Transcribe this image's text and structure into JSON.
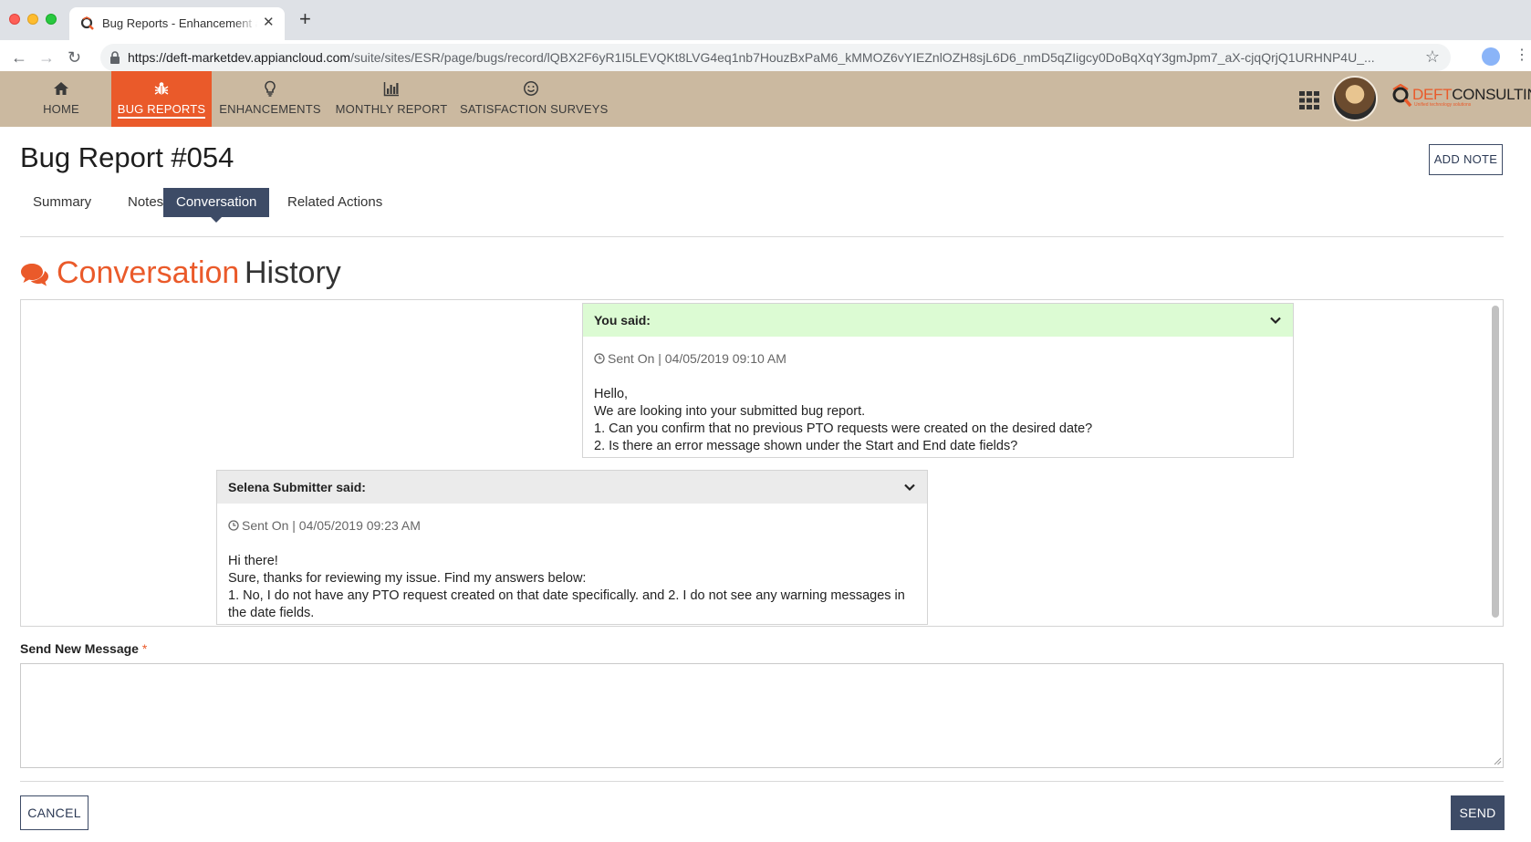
{
  "browser": {
    "tab_title": "Bug Reports - Enhancement and",
    "url_host": "https://deft-marketdev.appiancloud.com",
    "url_path": "/suite/sites/ESR/page/bugs/record/lQBX2F6yR1I5LEVQKt8LVG4eq1nb7HouzBxPaM6_kMMOZ6vYIEZnlOZH8sjL6D6_nmD5qZIigcy0DoBqXqY3gmJpm7_aX-cjqQrjQ1URHNP4U_..."
  },
  "nav": {
    "items": [
      {
        "label": "HOME",
        "icon": "home-icon"
      },
      {
        "label": "BUG REPORTS",
        "icon": "bug-icon",
        "active": true
      },
      {
        "label": "ENHANCEMENTS",
        "icon": "lightbulb-icon"
      },
      {
        "label": "MONTHLY REPORT",
        "icon": "bar-chart-icon"
      },
      {
        "label": "SATISFACTION SURVEYS",
        "icon": "smiley-icon"
      }
    ],
    "brand_part1": "DEFT",
    "brand_part2": "CONSULTING",
    "brand_tagline": "Unified technology solutions"
  },
  "page": {
    "title": "Bug Report #054",
    "add_note_label": "ADD NOTE",
    "tabs": [
      "Summary",
      "Notes",
      "Conversation",
      "Related Actions"
    ],
    "active_tab": "Conversation"
  },
  "conversation": {
    "heading_accent": "Conversation",
    "heading_rest": "History",
    "messages": [
      {
        "author": "You said:",
        "sent_on": "Sent On | 04/05/2019 09:10 AM",
        "lines": [
          "Hello,",
          "We are looking into your submitted bug report.",
          "1. Can you confirm that no previous PTO requests were created on the desired date?",
          "2. Is there an error message shown under the Start and End date fields?"
        ]
      },
      {
        "author": "Selena Submitter said:",
        "sent_on": "Sent On | 04/05/2019 09:23 AM",
        "lines": [
          "Hi there!",
          "Sure, thanks for reviewing my issue. Find my answers below:",
          "1. No, I do not have any PTO request created on that date specifically. and 2. I do not see any warning messages in the date fields."
        ]
      }
    ]
  },
  "form": {
    "label": "Send New Message",
    "required_mark": "*",
    "message_value": "",
    "cancel_label": "CANCEL",
    "send_label": "SEND"
  },
  "colors": {
    "accent": "#ea5a2a",
    "header_bg": "#cbb9a0",
    "navy": "#3d4b66",
    "you_header": "#dcfbd3",
    "other_header": "#ebebeb"
  }
}
